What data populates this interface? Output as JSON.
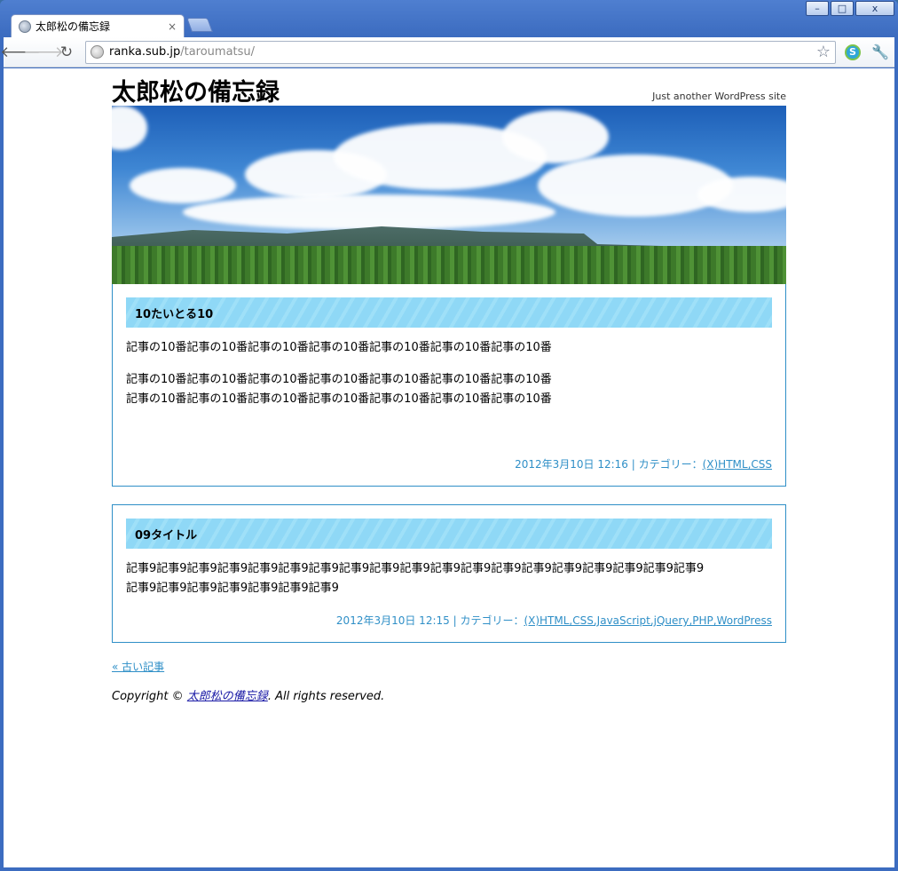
{
  "browser": {
    "tab_title": "太郎松の備忘録",
    "tab_close": "×",
    "url_host": "ranka.sub.jp",
    "url_path": "/taroumatsu/",
    "win_minimize": "–",
    "win_maximize": "□",
    "win_close": "x"
  },
  "site": {
    "title": "太郎松の備忘録",
    "description": "Just another WordPress site"
  },
  "posts": [
    {
      "title": "10たいとる10",
      "paragraphs": [
        "記事の10番記事の10番記事の10番記事の10番記事の10番記事の10番記事の10番",
        "記事の10番記事の10番記事の10番記事の10番記事の10番記事の10番記事の10番",
        "記事の10番記事の10番記事の10番記事の10番記事の10番記事の10番記事の10番"
      ],
      "date": "2012年3月10日 12:16",
      "category_label": "| カテゴリー：",
      "categories": [
        "(X)HTML,CSS"
      ]
    },
    {
      "title": "09タイトル",
      "paragraphs": [
        "記事9記事9記事9記事9記事9記事9記事9記事9記事9記事9記事9記事9記事9記事9記事9記事9記事9記事9記事9",
        "記事9記事9記事9記事9記事9記事9記事9"
      ],
      "date": "2012年3月10日 12:15",
      "category_label": "| カテゴリー：",
      "categories": [
        "(X)HTML,CSS,JavaScript,jQuery,PHP,WordPress"
      ]
    }
  ],
  "pagination": {
    "older": "« 古い記事"
  },
  "footer": {
    "prefix": "Copyright © ",
    "site_link": "太郎松の備忘録",
    "suffix": ". All rights reserved."
  },
  "colors": {
    "accent": "#2f8fc7",
    "title_bar": "#8fd8f6"
  }
}
